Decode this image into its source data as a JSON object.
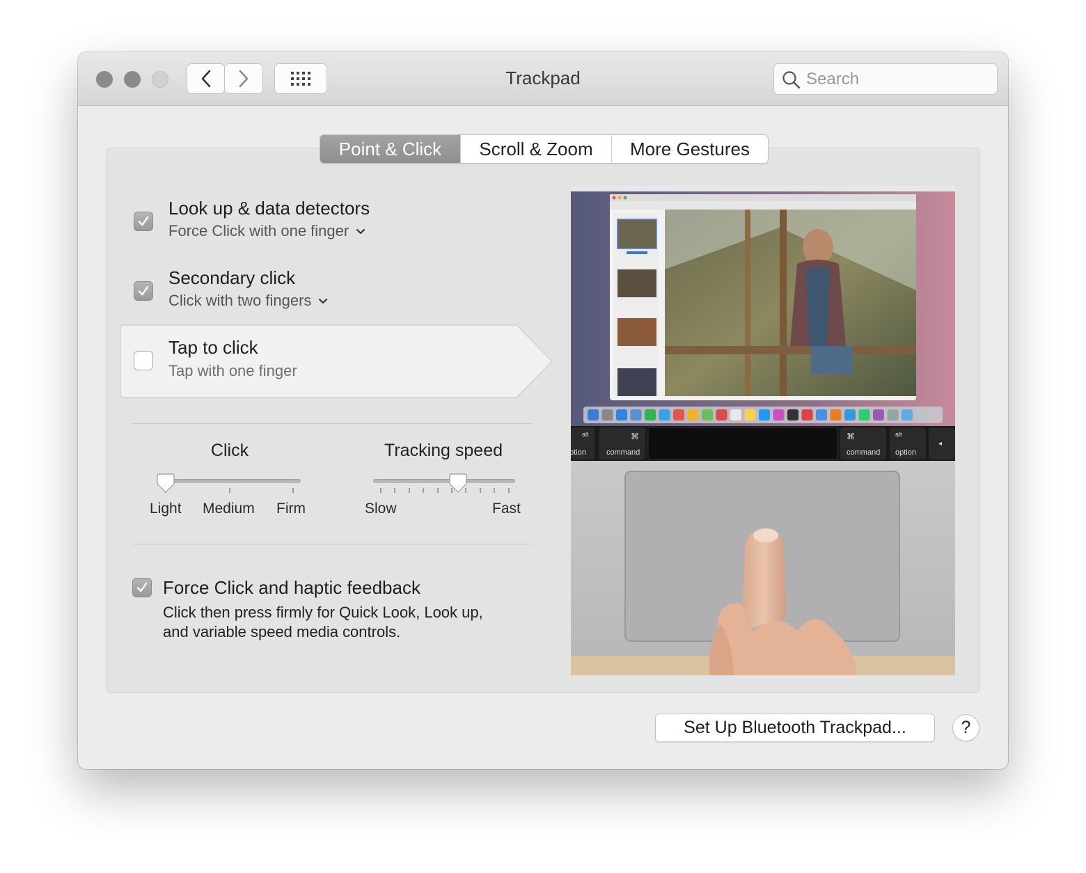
{
  "window": {
    "title": "Trackpad"
  },
  "toolbar": {
    "back_icon": "chevron-left-icon",
    "forward_icon": "chevron-right-icon",
    "grid_icon": "show-all-grid-icon"
  },
  "search": {
    "placeholder": "Search",
    "icon": "search-icon"
  },
  "tabs": [
    {
      "label": "Point & Click",
      "active": true
    },
    {
      "label": "Scroll & Zoom",
      "active": false
    },
    {
      "label": "More Gestures",
      "active": false
    }
  ],
  "options": {
    "lookup": {
      "title": "Look up & data detectors",
      "subtitle": "Force Click with one finger",
      "checked": true
    },
    "secondary": {
      "title": "Secondary click",
      "subtitle": "Click with two fingers",
      "checked": true
    },
    "tap": {
      "title": "Tap to click",
      "subtitle": "Tap with one finger",
      "checked": false
    }
  },
  "sliders": {
    "click": {
      "label": "Click",
      "ticks": [
        "Light",
        "Medium",
        "Firm"
      ],
      "value": "Light"
    },
    "tracking": {
      "label": "Tracking speed",
      "min_label": "Slow",
      "max_label": "Fast",
      "value_fraction": 0.6
    }
  },
  "force_click": {
    "title": "Force Click and haptic feedback",
    "description_line1": "Click then press firmly for Quick Look, Look up,",
    "description_line2": "and variable speed media controls.",
    "checked": true
  },
  "preview": {
    "keys": {
      "alt": "alt",
      "option": "option",
      "command": "command",
      "cmd_symbol": "⌘",
      "option_cut": "ption",
      "arrow": "◂"
    }
  },
  "footer": {
    "setup_button": "Set Up Bluetooth Trackpad...",
    "help_button": "?"
  },
  "colors": {
    "active_tab": "#9a9a9a",
    "checkbox": "#a7a7a7",
    "window_bg": "#ececec"
  }
}
